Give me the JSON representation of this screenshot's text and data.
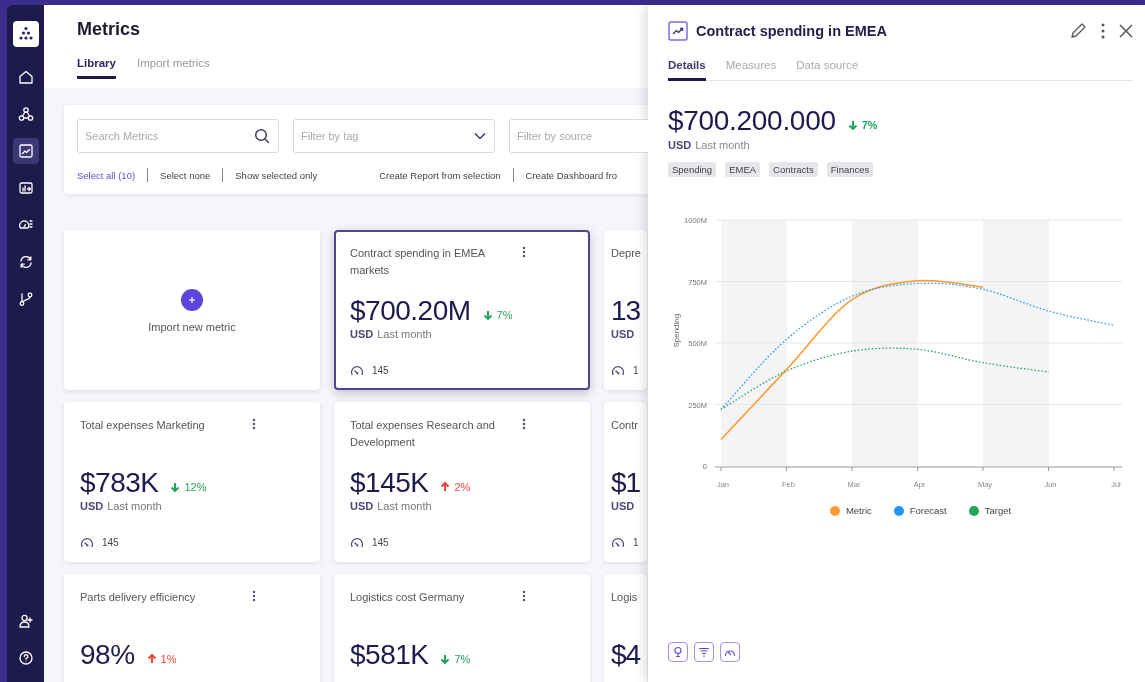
{
  "sidebar": {
    "items": [
      {
        "selected": false
      },
      {
        "selected": false
      },
      {
        "selected": true
      },
      {
        "selected": false
      },
      {
        "selected": false
      },
      {
        "selected": false
      },
      {
        "selected": false
      }
    ],
    "bottom_items": [
      {
        "selected": false
      },
      {
        "selected": false
      }
    ]
  },
  "page": {
    "title": "Metrics",
    "tabs": [
      {
        "label": "Library",
        "selected": true
      },
      {
        "label": "Import metrics",
        "selected": false
      }
    ]
  },
  "filters": {
    "search": {
      "placeholder": "Search Metrics"
    },
    "tag": {
      "placeholder": "Filter by tag"
    },
    "source": {
      "placeholder": "Filter by source"
    },
    "selection_actions": [
      {
        "label": "Select all (10)",
        "active": true
      },
      {
        "label": "Select none",
        "active": false
      },
      {
        "label": "Show selected only",
        "active": false
      }
    ],
    "create_actions": [
      "Create Report from selection",
      "Create Dashboard fro"
    ]
  },
  "cards": [
    {
      "kind": "import",
      "label": "Import new metric",
      "selected": false
    },
    {
      "kind": "metric",
      "title": "Contract spending in EMEA markets",
      "value": "$700.20M",
      "change": {
        "text": "7%",
        "rising": false,
        "good": true
      },
      "currency": "USD",
      "period": "Last month",
      "count": "145",
      "selected": true
    },
    {
      "kind": "metric",
      "title": "Depre",
      "value": "13",
      "currency": "USD",
      "count": "1",
      "selected": false
    },
    {
      "kind": "metric",
      "title": "Total expenses Marketing",
      "value": "$783K",
      "change": {
        "text": "12%",
        "rising": false,
        "good": true
      },
      "currency": "USD",
      "period": "Last month",
      "count": "145",
      "selected": false
    },
    {
      "kind": "metric",
      "title": "Total expenses Research and Development",
      "value": "$145K",
      "change": {
        "text": "2%",
        "rising": true,
        "good": false
      },
      "currency": "USD",
      "period": "Last month",
      "count": "145",
      "selected": false
    },
    {
      "kind": "metric",
      "title": "Contr",
      "value": "$1",
      "currency": "USD",
      "count": "1",
      "selected": false
    },
    {
      "kind": "metric",
      "title": "Parts delivery efficiency",
      "value": "98%",
      "change": {
        "text": "1%",
        "rising": true,
        "good": false
      },
      "selected": false
    },
    {
      "kind": "metric",
      "title": "Logistics cost Germany",
      "value": "$581K",
      "change": {
        "text": "7%",
        "rising": false,
        "good": true
      },
      "selected": false
    },
    {
      "kind": "metric",
      "title": "Logis",
      "value": "$4",
      "selected": false
    }
  ],
  "panel": {
    "title": "Contract spending in EMEA",
    "tabs": [
      {
        "label": "Details",
        "selected": true
      },
      {
        "label": "Measures",
        "selected": false
      },
      {
        "label": "Data source",
        "selected": false
      }
    ],
    "value": "$700.200.000",
    "change": {
      "text": "7%",
      "rising": false,
      "good": true
    },
    "currency": "USD",
    "period": "Last month",
    "tags": [
      "Spending",
      "EMEA",
      "Contracts",
      "Finances"
    ],
    "chart_data": {
      "type": "line",
      "ylabel": "Spending",
      "categories": [
        "Jan",
        "Feb",
        "Mar",
        "Apr",
        "May",
        "Jun",
        "Jul"
      ],
      "yticks": [
        {
          "value": 0,
          "label": "0"
        },
        {
          "value": 250,
          "label": "250M"
        },
        {
          "value": 500,
          "label": "500M"
        },
        {
          "value": 750,
          "label": "750M"
        },
        {
          "value": 1000,
          "label": "1000M"
        }
      ],
      "ylim": [
        0,
        1000
      ],
      "grid": true,
      "series": [
        {
          "name": "Metric",
          "color": "#ff9a2e",
          "line_style": "solid",
          "values": [
            108,
            392,
            676,
            753,
            727,
            null,
            null
          ]
        },
        {
          "name": "Forecast",
          "color": "#2196f3",
          "line_style": "dotted",
          "values": [
            230,
            515,
            690,
            742,
            718,
            630,
            572
          ]
        },
        {
          "name": "Target",
          "color": "#22a559",
          "line_style": "dotted",
          "values": [
            230,
            386,
            467,
            474,
            420,
            382,
            null
          ]
        }
      ]
    }
  }
}
